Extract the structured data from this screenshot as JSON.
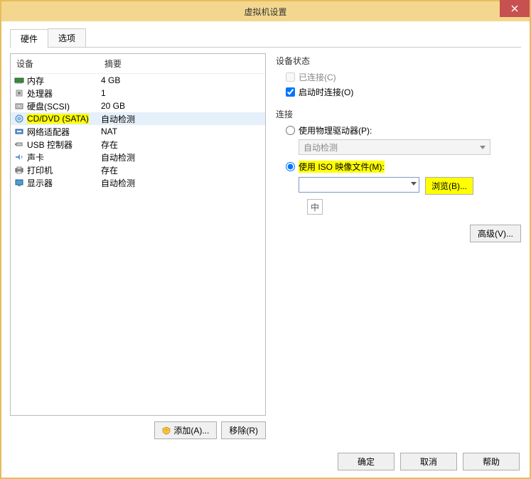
{
  "title": "虚拟机设置",
  "tabs": {
    "hardware": "硬件",
    "options": "选项"
  },
  "hw_header": {
    "device": "设备",
    "summary": "摘要"
  },
  "hw": [
    {
      "icon": "memory",
      "name": "内存",
      "summary": "4 GB"
    },
    {
      "icon": "cpu",
      "name": "处理器",
      "summary": "1"
    },
    {
      "icon": "disk",
      "name": "硬盘(SCSI)",
      "summary": "20 GB"
    },
    {
      "icon": "cd",
      "name": "CD/DVD (SATA)",
      "summary": "自动检测",
      "selected": true,
      "highlight": true
    },
    {
      "icon": "net",
      "name": "网络适配器",
      "summary": "NAT"
    },
    {
      "icon": "usb",
      "name": "USB 控制器",
      "summary": "存在"
    },
    {
      "icon": "sound",
      "name": "声卡",
      "summary": "自动检测"
    },
    {
      "icon": "printer",
      "name": "打印机",
      "summary": "存在"
    },
    {
      "icon": "display",
      "name": "显示器",
      "summary": "自动检测"
    }
  ],
  "buttons": {
    "add": "添加(A)...",
    "remove": "移除(R)",
    "browse": "浏览(B)...",
    "advanced": "高级(V)...",
    "ok": "确定",
    "cancel": "取消",
    "help": "帮助"
  },
  "right": {
    "status_label": "设备状态",
    "connected": "已连接(C)",
    "connect_at_poweron": "启动时连接(O)",
    "connection_label": "连接",
    "use_physical": "使用物理驱动器(P):",
    "auto_detect": "自动检测",
    "use_iso": "使用 ISO 映像文件(M):",
    "iso_value": "",
    "ime": "中"
  }
}
